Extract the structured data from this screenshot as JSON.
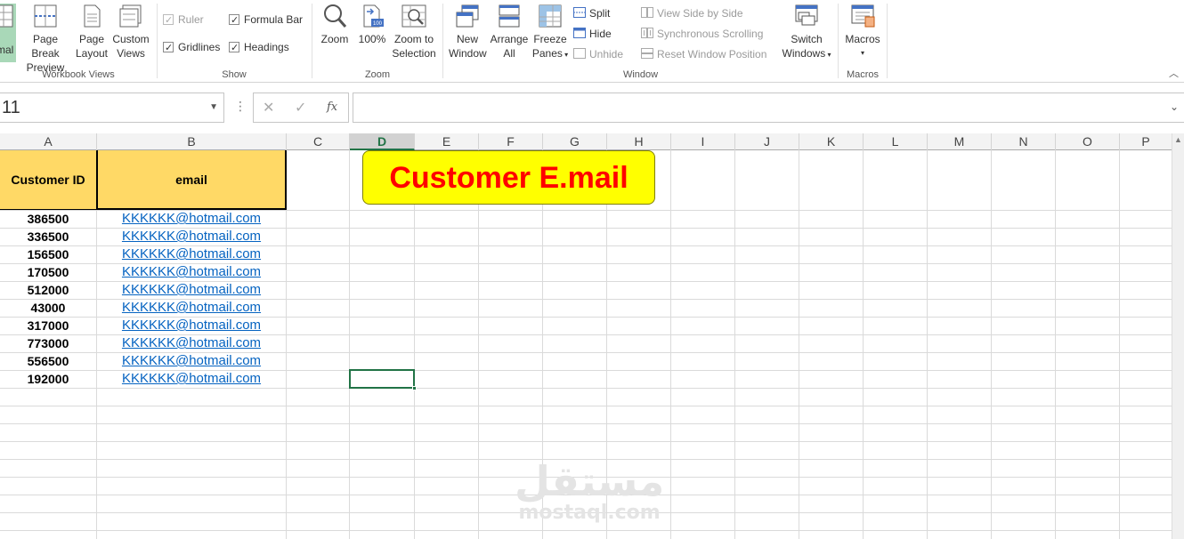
{
  "ribbon": {
    "workbook_views": {
      "label": "Workbook Views",
      "normal": "rmal",
      "page_break_1": "Page Break",
      "page_break_2": "Preview",
      "page_layout_1": "Page",
      "page_layout_2": "Layout",
      "custom_1": "Custom",
      "custom_2": "Views"
    },
    "show": {
      "label": "Show",
      "ruler": "Ruler",
      "formula_bar": "Formula Bar",
      "gridlines": "Gridlines",
      "headings": "Headings"
    },
    "zoom": {
      "label": "Zoom",
      "zoom": "Zoom",
      "hundred": "100%",
      "zoom_sel_1": "Zoom to",
      "zoom_sel_2": "Selection",
      "icon_badge": "100"
    },
    "window": {
      "label": "Window",
      "new_1": "New",
      "new_2": "Window",
      "arrange_1": "Arrange",
      "arrange_2": "All",
      "freeze_1": "Freeze",
      "freeze_2": "Panes",
      "split": "Split",
      "hide": "Hide",
      "unhide": "Unhide",
      "side_by_side": "View Side by Side",
      "sync_scroll": "Synchronous Scrolling",
      "reset_pos": "Reset Window Position",
      "switch_1": "Switch",
      "switch_2": "Windows"
    },
    "macros": {
      "label": "Macros",
      "btn": "Macros"
    }
  },
  "formula_bar": {
    "name_box": "11",
    "cancel": "✕",
    "enter": "✓",
    "fx": "fx",
    "dots": "⋮",
    "content": ""
  },
  "sheet": {
    "columns": [
      "A",
      "B",
      "C",
      "D",
      "E",
      "F",
      "G",
      "H",
      "I",
      "J",
      "K",
      "L",
      "M",
      "N",
      "O",
      "P"
    ],
    "selected_column": "D",
    "headers": {
      "customer_id": "Customer ID",
      "email": "email"
    },
    "rows": [
      {
        "id": "386500",
        "email": "KKKKKK@hotmail.com"
      },
      {
        "id": "336500",
        "email": "KKKKKK@hotmail.com"
      },
      {
        "id": "156500",
        "email": "KKKKKK@hotmail.com"
      },
      {
        "id": "170500",
        "email": "KKKKKK@hotmail.com"
      },
      {
        "id": "512000",
        "email": "KKKKKK@hotmail.com"
      },
      {
        "id": "43000",
        "email": "KKKKKK@hotmail.com"
      },
      {
        "id": "317000",
        "email": "KKKKKK@hotmail.com"
      },
      {
        "id": "773000",
        "email": "KKKKKK@hotmail.com"
      },
      {
        "id": "556500",
        "email": "KKKKKK@hotmail.com"
      },
      {
        "id": "192000",
        "email": "KKKKKK@hotmail.com"
      }
    ],
    "title_box": "Customer E.mail"
  },
  "watermark": {
    "arabic": "مستقل",
    "latin": "mostaql.com"
  },
  "colors": {
    "header_fill": "#ffd966",
    "title_fill": "#ffff00",
    "title_text": "#ff0000",
    "link": "#0563c1",
    "accent": "#217346"
  }
}
